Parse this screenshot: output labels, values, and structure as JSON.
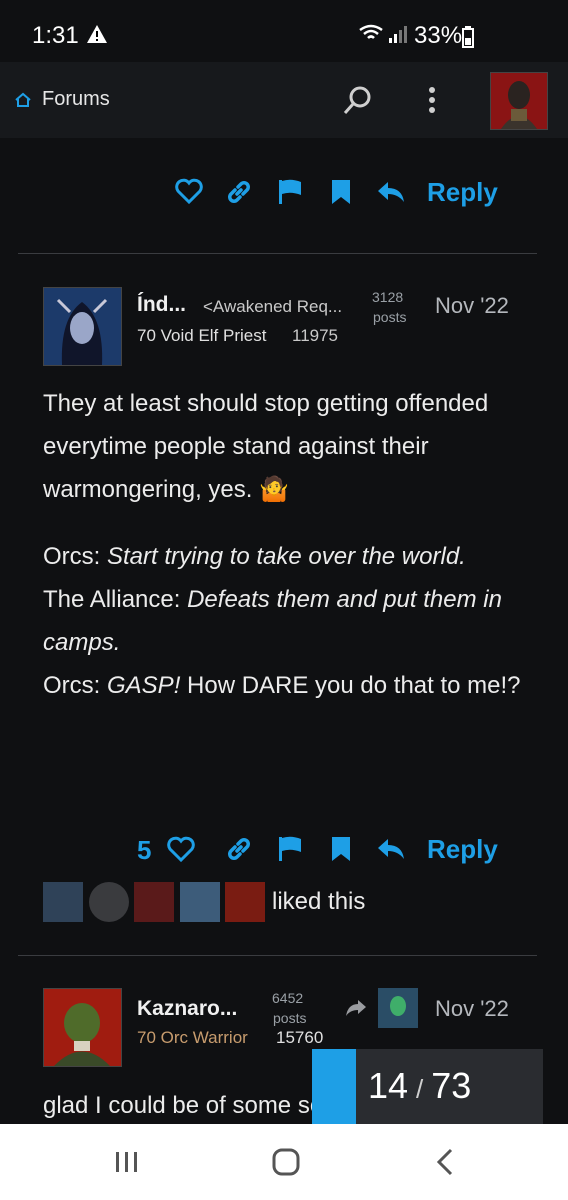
{
  "status": {
    "time": "1:31",
    "battery": "33%"
  },
  "header": {
    "forums_label": "Forums"
  },
  "actions": {
    "reply_label": "Reply"
  },
  "post1": {
    "username": "Índ...",
    "title": "<Awakened Req...",
    "class_line": "70 Void Elf Priest",
    "achievement_points": "11975",
    "post_count": "3128",
    "posts_label": "posts",
    "date": "Nov '22",
    "paragraph1": "They at least should stop getting offended everytime people stand against their warmongering, yes. 🤷",
    "line_orcs1_speaker": "Orcs:",
    "line_orcs1_text": "Start trying to take over the world.",
    "line_alliance_speaker": "The Alliance:",
    "line_alliance_text": "Defeats them and put them in camps.",
    "line_orcs2_speaker": "Orcs:",
    "line_orcs2_gasp": "GASP!",
    "line_orcs2_rest": "How DARE you do that to me!?",
    "like_count": "5",
    "liked_label": "liked this"
  },
  "post2": {
    "username": "Kaznaro...",
    "class_line": "70 Orc Warrior",
    "achievement_points": "15760",
    "post_count": "6452",
    "posts_label": "posts",
    "date": "Nov '22",
    "snippet": "glad I could be of some service."
  },
  "progress": {
    "current": "14",
    "separator": "/",
    "total": "73",
    "fraction": 0.19
  },
  "colors": {
    "accent": "#1e9fe6",
    "background": "#0f1012",
    "orc_warrior_class": "#c79c6e"
  }
}
